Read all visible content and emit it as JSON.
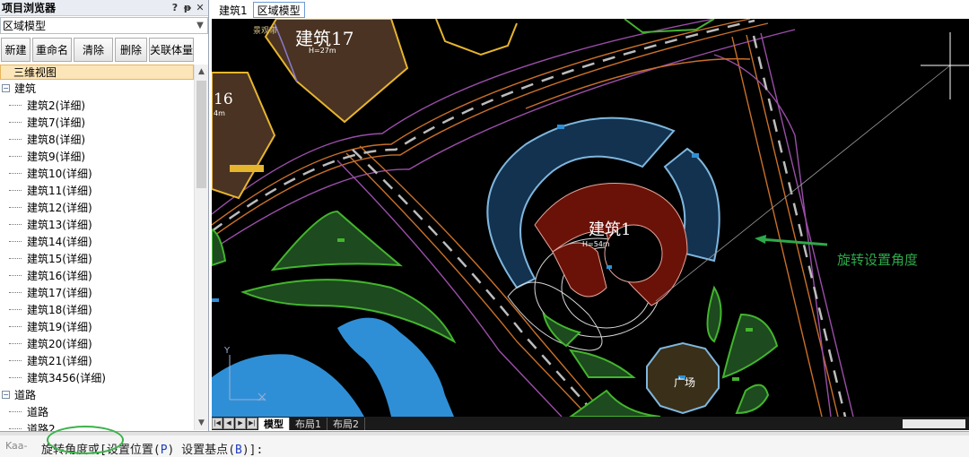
{
  "panel": {
    "title": "项目浏览器",
    "controls": [
      "?",
      "ᵽ",
      "✕"
    ],
    "dropdown_value": "区域模型",
    "buttons": [
      "新建",
      "重命名",
      "清除",
      "删除",
      "关联体量"
    ]
  },
  "tree": {
    "selected": "三维视图",
    "group_buildings": "建筑",
    "buildings": [
      "建筑2(详细)",
      "建筑7(详细)",
      "建筑8(详细)",
      "建筑9(详细)",
      "建筑10(详细)",
      "建筑11(详细)",
      "建筑12(详细)",
      "建筑13(详细)",
      "建筑14(详细)",
      "建筑15(详细)",
      "建筑16(详细)",
      "建筑17(详细)",
      "建筑18(详细)",
      "建筑19(详细)",
      "建筑20(详细)",
      "建筑21(详细)",
      "建筑3456(详细)"
    ],
    "group_roads": "道路",
    "roads": [
      "道路",
      "道路2"
    ]
  },
  "doc_tabs": [
    "建筑1",
    "区域模型"
  ],
  "canvas": {
    "label_b17": "建筑17",
    "label_b17_h": "H=27m",
    "label_b17_small": "景观带",
    "label_b16": "16",
    "label_b16_h": "4m",
    "label_b1": "建筑1",
    "label_b1_h": "H=54m",
    "label_square": "广场",
    "annotation": "旋转设置角度"
  },
  "layout_tabs": [
    "模型",
    "布局1",
    "布局2"
  ],
  "command": {
    "prefix": "旋转角度或",
    "opt1": "设置位置",
    "key1": "P",
    "opt2": "设置基点",
    "key2": "B",
    "suffix": "]:",
    "watermark": "Kaa-"
  },
  "colors": {
    "canvas_bg": "#000000",
    "building_fill": "#4a3322",
    "building_outline": "#e6b52e",
    "dome_fill": "#12324f",
    "dome_outline": "#7fb6dd",
    "core_fill": "#6b1208",
    "water": "#2f8fd6",
    "green_fill": "#1d4a1e",
    "green_outline": "#43b52e",
    "annotation": "#2ea84a"
  }
}
